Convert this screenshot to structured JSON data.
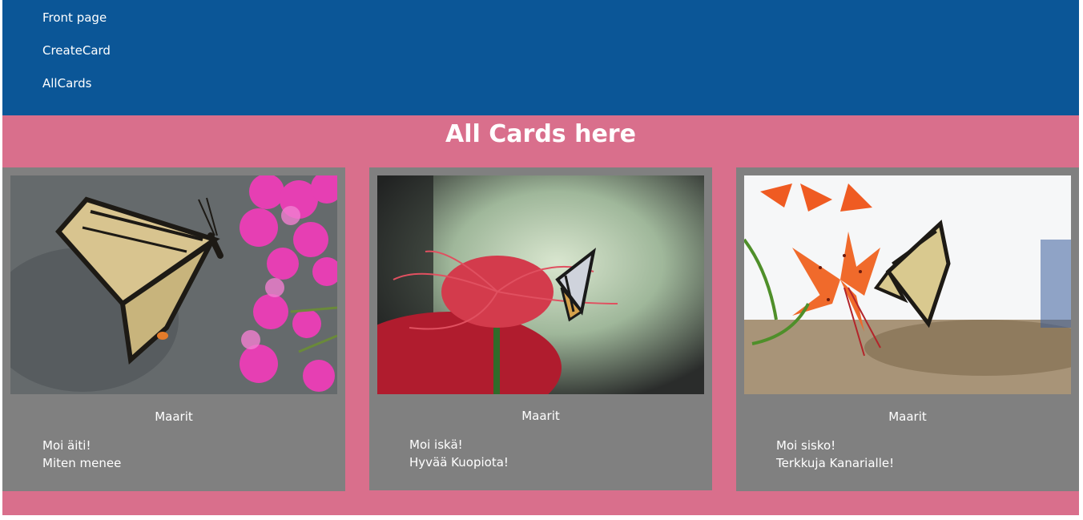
{
  "nav": {
    "items": [
      {
        "label": "Front page"
      },
      {
        "label": "CreateCard"
      },
      {
        "label": "AllCards"
      }
    ]
  },
  "page": {
    "title": "All Cards here"
  },
  "cards": [
    {
      "sender": "Maarit",
      "message_line1": "Moi äiti!",
      "message_line2": "Miten menee"
    },
    {
      "sender": "Maarit",
      "message_line1": "Moi iskä!",
      "message_line2": "Hyvää Kuopiota!"
    },
    {
      "sender": "Maarit",
      "message_line1": "Moi sisko!",
      "message_line2": "Terkkuja Kanarialle!"
    }
  ],
  "colors": {
    "nav_background": "#0b5697",
    "page_background": "#d96f8c",
    "card_background": "#808080",
    "text": "#ffffff"
  }
}
